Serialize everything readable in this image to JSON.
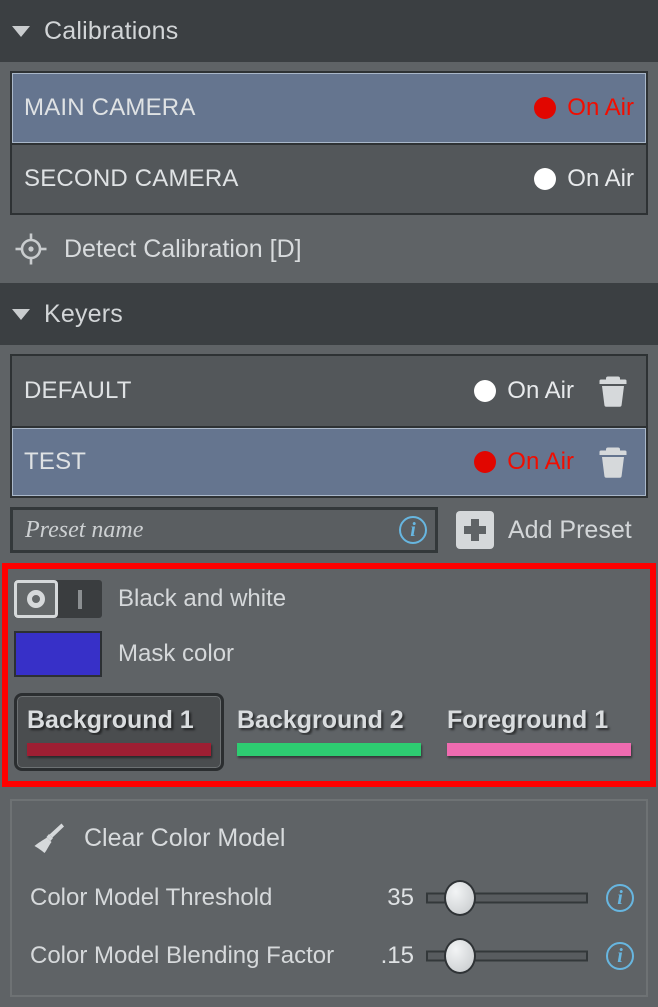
{
  "calibrations": {
    "header": {
      "title": "Calibrations",
      "icon": "chevron-down-icon"
    },
    "items": [
      {
        "name": "MAIN CAMERA",
        "on_air_label": "On Air",
        "live": true
      },
      {
        "name": "SECOND CAMERA",
        "on_air_label": "On Air",
        "live": false
      }
    ],
    "detect": {
      "label": "Detect Calibration [D]",
      "icon": "crosshair-icon"
    }
  },
  "keyers": {
    "header": {
      "title": "Keyers",
      "icon": "chevron-down-icon"
    },
    "items": [
      {
        "name": "DEFAULT",
        "on_air_label": "On Air",
        "live": false,
        "delete_icon": "trash-icon"
      },
      {
        "name": "TEST",
        "on_air_label": "On Air",
        "live": true,
        "delete_icon": "trash-icon"
      }
    ],
    "preset": {
      "placeholder": "Preset name",
      "value": "",
      "info_icon": "info-icon",
      "add_label": "Add Preset",
      "add_icon": "plus-icon"
    }
  },
  "highlight": {
    "border_color": "#fe0000",
    "toggle": {
      "label": "Black and white",
      "off_glyph": "O",
      "on_glyph": "I",
      "selected": "off"
    },
    "mask": {
      "label": "Mask color",
      "color": "#3730c8"
    },
    "tabs": [
      {
        "label": "Background 1",
        "color": "#9e1f33",
        "active": true
      },
      {
        "label": "Background 2",
        "color": "#2ecc71",
        "active": false
      },
      {
        "label": "Foreground 1",
        "color": "#ef6bb0",
        "active": false
      }
    ]
  },
  "color_model": {
    "clear": {
      "label": "Clear Color Model",
      "icon": "brush-icon"
    },
    "sliders": [
      {
        "label": "Color Model Threshold",
        "value": "35",
        "fraction": 0.21,
        "info_icon": "info-icon"
      },
      {
        "label": "Color Model Blending Factor",
        "value": ".15",
        "fraction": 0.21,
        "info_icon": "info-icon"
      }
    ]
  }
}
